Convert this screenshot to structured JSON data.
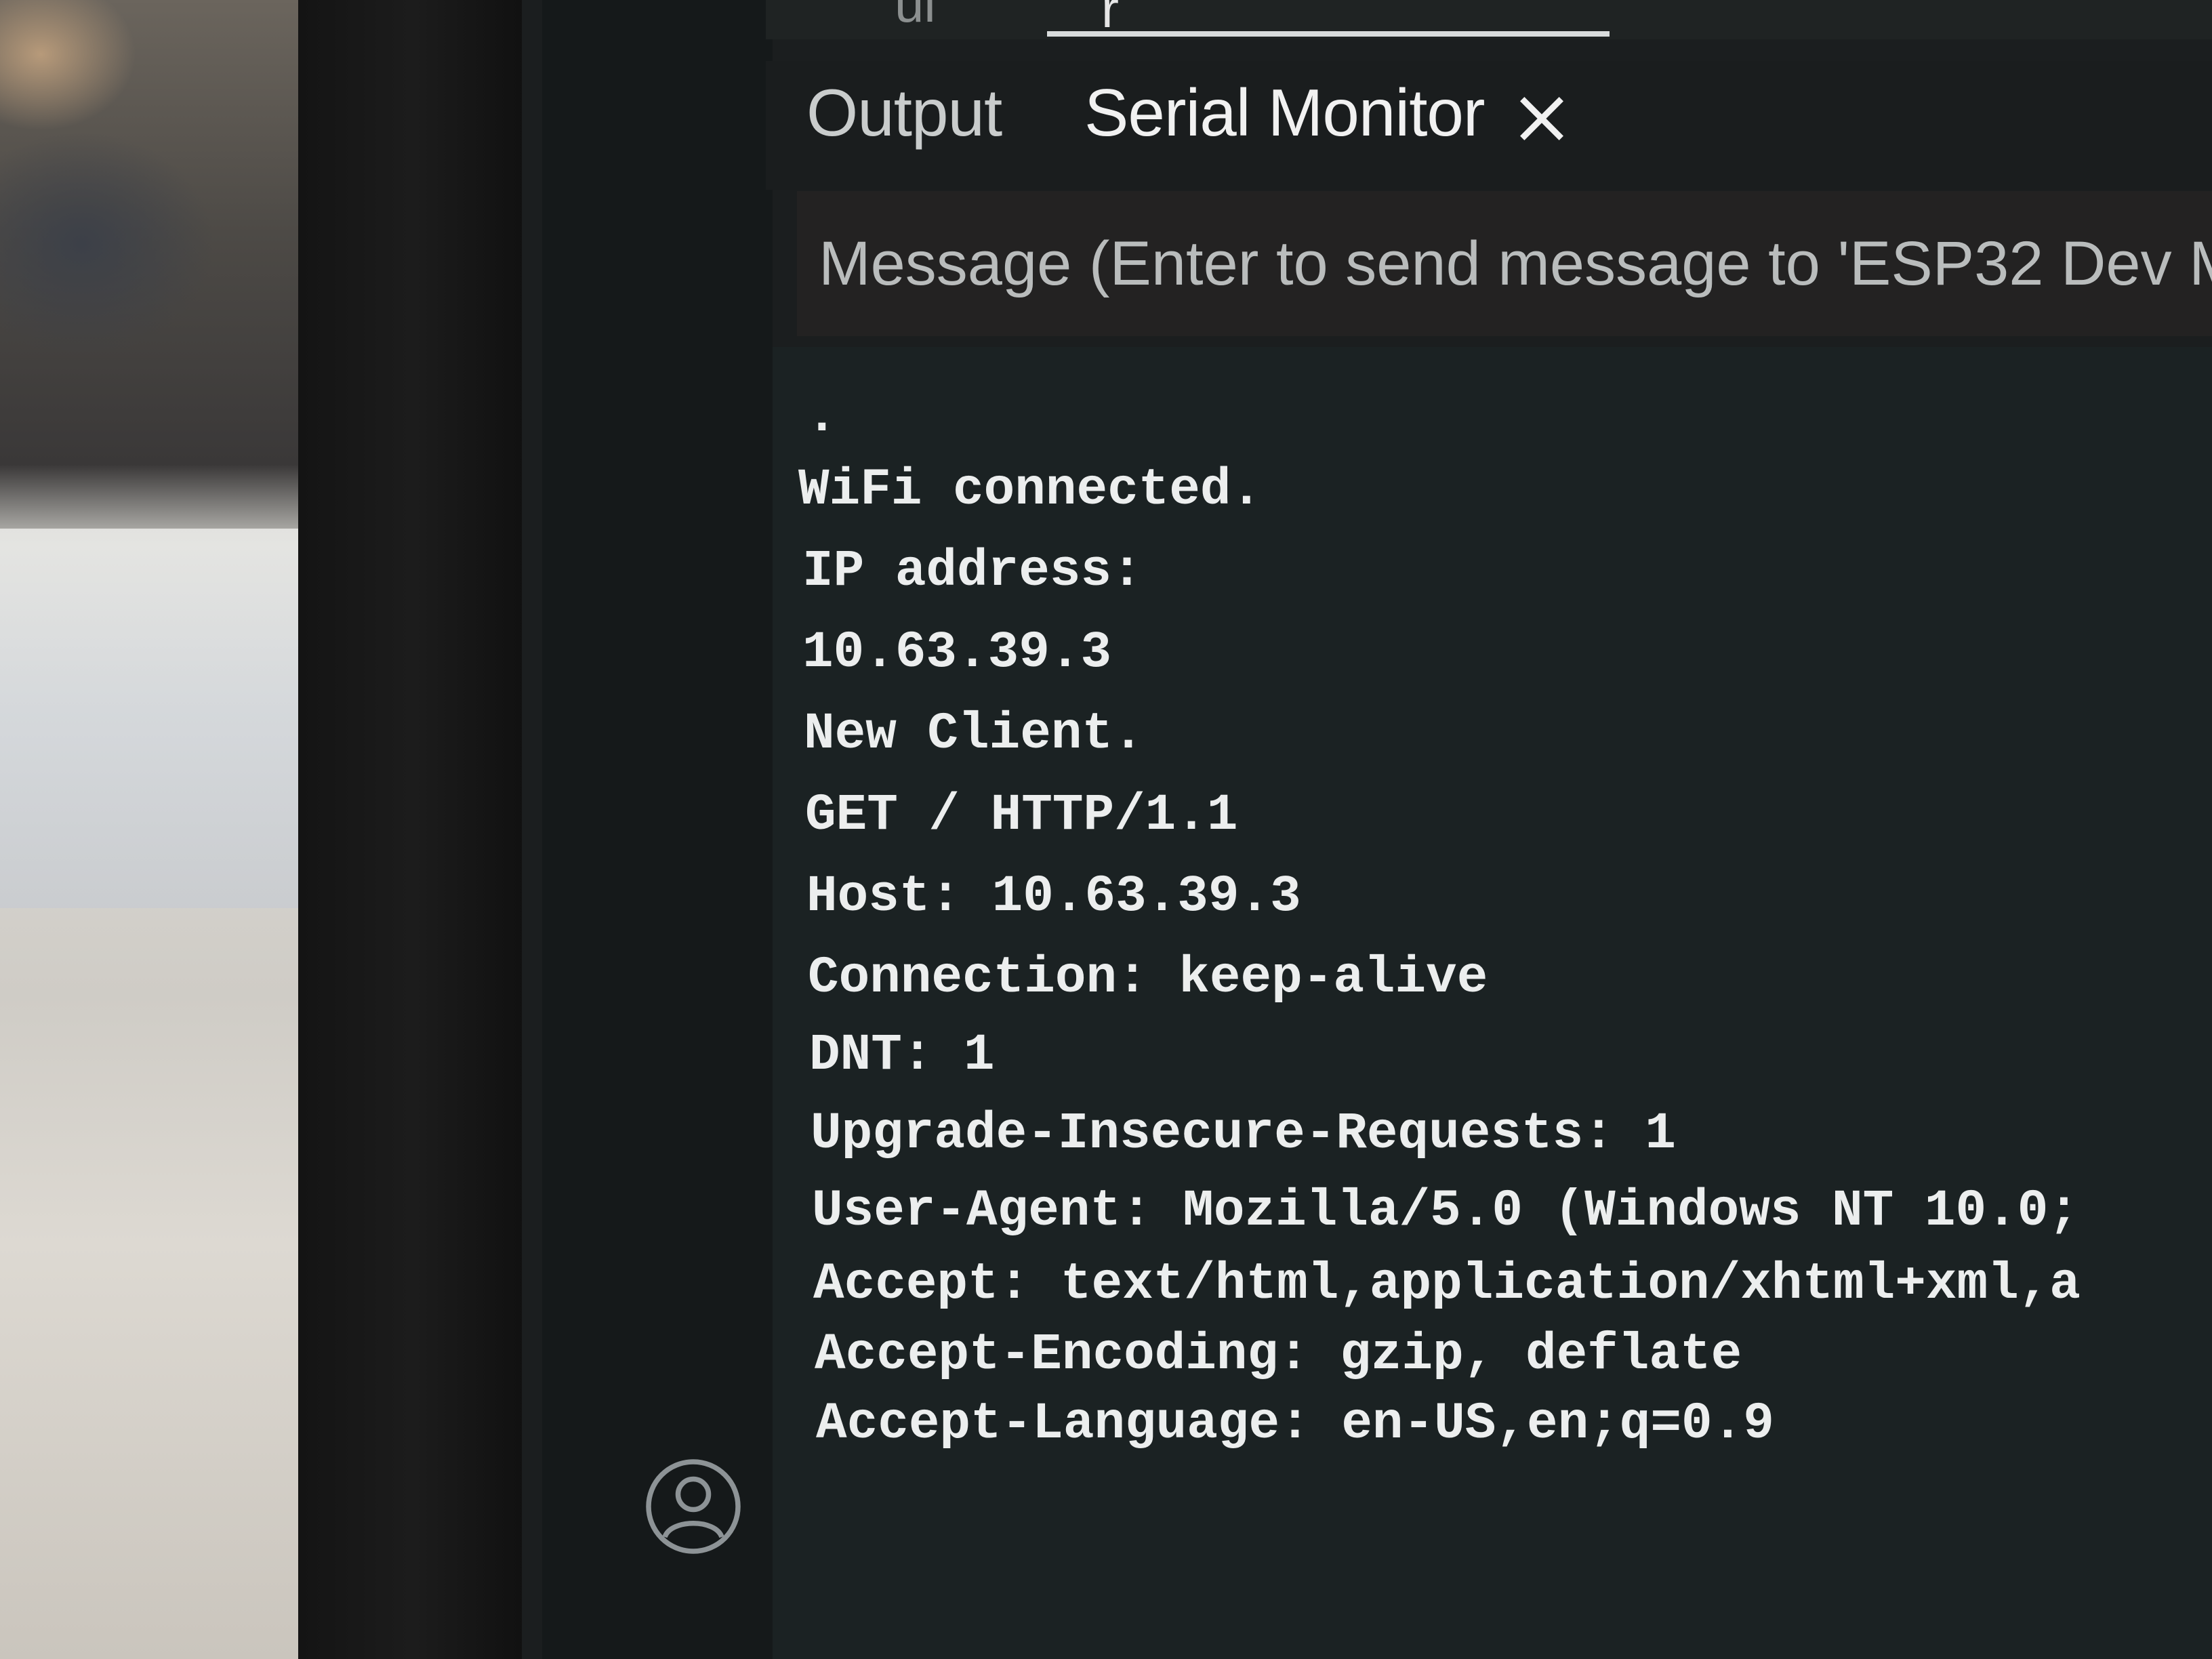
{
  "top_tabs": {
    "partial_label": "ui",
    "active_partial": "r"
  },
  "panel": {
    "tabs": [
      {
        "label": "Output"
      },
      {
        "label": "Serial Monitor"
      }
    ],
    "close_icon": "close-icon"
  },
  "message_input": {
    "placeholder": "Message (Enter to send message to 'ESP32 Dev M"
  },
  "serial_lines": [
    ".",
    "WiFi connected.",
    "IP address:",
    "10.63.39.3",
    "New Client.",
    "GET / HTTP/1.1",
    "Host: 10.63.39.3",
    "Connection: keep-alive",
    "DNT: 1",
    "Upgrade-Insecure-Requests: 1",
    "User-Agent: Mozilla/5.0 (Windows NT 10.0;",
    "Accept: text/html,application/xhtml+xml,a",
    "Accept-Encoding: gzip, deflate",
    "Accept-Language: en-US,en;q=0.9"
  ],
  "activity_bar": {
    "account_icon": "account-icon"
  },
  "colors": {
    "panel_background": "#1b2223",
    "input_background": "#232222",
    "text": "#eceeee"
  }
}
